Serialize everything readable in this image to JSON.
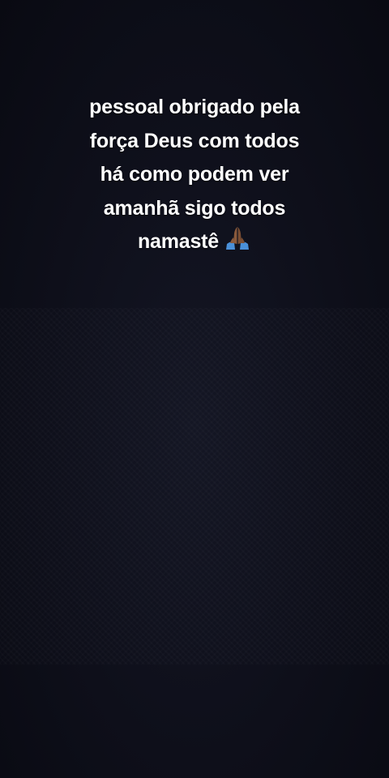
{
  "caption": {
    "lines": [
      "pessoal obrigado pela",
      "força Deus com todos",
      "há como podem ver",
      "amanhã sigo todos",
      "namastê"
    ],
    "emoji": "folded-hands-icon"
  },
  "colors": {
    "background": "#0d0e18",
    "text": "#ffffff",
    "emoji_skin": "#8a5a3c",
    "emoji_sleeve": "#4a90d9"
  }
}
